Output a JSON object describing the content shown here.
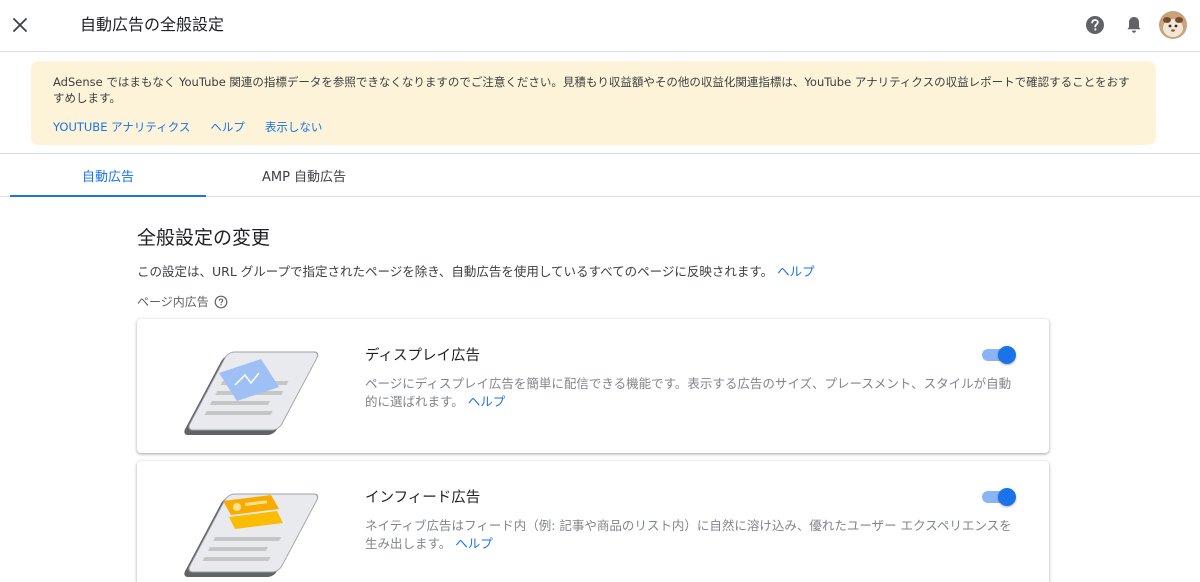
{
  "header": {
    "title": "自動広告の全般設定",
    "icons": [
      "close-icon",
      "help-icon",
      "bell-icon",
      "avatar"
    ]
  },
  "banner": {
    "message": "AdSense ではまもなく YouTube 関連の指標データを参照できなくなりますのでご注意ください。見積もり収益額やその他の収益化関連指標は、YouTube アナリティクスの収益レポートで確認することをおすすめします。",
    "actions": {
      "youtube_analytics": "YOUTUBE アナリティクス",
      "help": "ヘルプ",
      "dismiss": "表示しない"
    },
    "color": "#fdf3d8"
  },
  "tabs": {
    "auto_ads": "自動広告",
    "amp_auto_ads": "AMP 自動広告",
    "active": "auto_ads"
  },
  "main": {
    "title": "全般設定の変更",
    "description": "この設定は、URL グループで指定されたページを除き、自動広告を使用しているすべてのページに反映されます。",
    "description_link": "ヘルプ",
    "in_page_ads_label": "ページ内広告"
  },
  "cards": [
    {
      "title": "ディスプレイ広告",
      "description": "ページにディスプレイ広告を簡単に配信できる機能です。表示する広告のサイズ、プレースメント、スタイルが自動的に選ばれます。",
      "link": "ヘルプ",
      "enabled": true
    },
    {
      "title": "インフィード広告",
      "description": "ネイティブ広告はフィード内（例: 記事や商品のリスト内）に自然に溶け込み、優れたユーザー エクスペリエンスを生み出します。",
      "link": "ヘルプ",
      "enabled": true
    }
  ],
  "colors": {
    "accent": "#1a73e8",
    "toggle_track": "#8ab4f8",
    "display_ad_illustration": "#9ec0f5",
    "infeed_ad_illustration": "#f9ab00"
  }
}
